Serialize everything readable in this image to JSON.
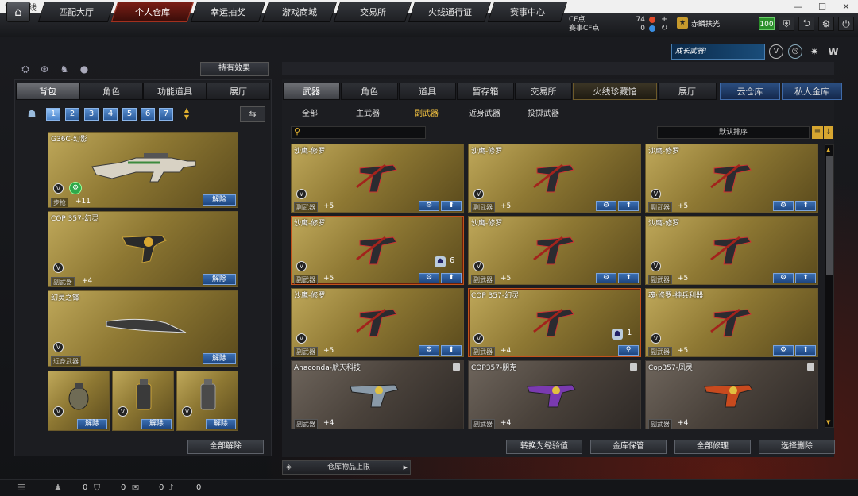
{
  "window": {
    "title": "穿越火线"
  },
  "nav": {
    "tabs": [
      "匹配大厅",
      "个人仓库",
      "幸运抽奖",
      "游戏商城",
      "交易所",
      "火线通行证",
      "赛事中心"
    ],
    "active": "个人仓库"
  },
  "currency": {
    "cf_label": "CF点",
    "cf_value": "74",
    "event_label": "赛事CF点",
    "event_value": "0"
  },
  "user": {
    "name": "赤鳞扶光",
    "level": "100"
  },
  "banner": {
    "growth_weapon": "成长武器!"
  },
  "left": {
    "effect_button": "持有效果",
    "tabs": [
      "背包",
      "角色",
      "功能道具",
      "展厅"
    ],
    "active_tab": "背包",
    "slots": [
      "1",
      "2",
      "3",
      "4",
      "5",
      "6",
      "7"
    ],
    "active_slot": "1",
    "items": [
      {
        "name": "G36C-幻影",
        "type": "步枪",
        "duration": "+11",
        "action": "解除"
      },
      {
        "name": "COP 357-幻灵",
        "type": "副武器",
        "duration": "+4",
        "action": "解除"
      },
      {
        "name": "幻灵之锋",
        "type": "近身武器",
        "duration": "",
        "action": "解除"
      }
    ],
    "throwables": [
      {
        "action": "解除"
      },
      {
        "action": "解除"
      },
      {
        "action": "解除"
      }
    ],
    "release_all": "全部解除"
  },
  "right": {
    "tabs": [
      "武器",
      "角色",
      "道具",
      "暂存箱",
      "交易所",
      "火线珍藏馆",
      "展厅"
    ],
    "active_tab": "武器",
    "storage_tabs": [
      "云仓库",
      "私人金库"
    ],
    "filters": [
      "全部",
      "主武器",
      "副武器",
      "近身武器",
      "投掷武器"
    ],
    "active_filter": "副武器",
    "search_placeholder": "",
    "sort": "默认排序",
    "items": [
      {
        "name": "沙鹰-修罗",
        "type": "副武器",
        "duration": "+5",
        "count": ""
      },
      {
        "name": "沙鹰-修罗",
        "type": "副武器",
        "duration": "+5",
        "count": ""
      },
      {
        "name": "沙鹰-修罗",
        "type": "副武器",
        "duration": "+5",
        "count": ""
      },
      {
        "name": "沙鹰-修罗",
        "type": "副武器",
        "duration": "+5",
        "count": "6"
      },
      {
        "name": "沙鹰-修罗",
        "type": "副武器",
        "duration": "+5",
        "count": ""
      },
      {
        "name": "沙鹰-修罗",
        "type": "副武器",
        "duration": "+5",
        "count": ""
      },
      {
        "name": "沙鹰-修罗",
        "type": "副武器",
        "duration": "+5",
        "count": ""
      },
      {
        "name": "COP 357-幻灵",
        "type": "副武器",
        "duration": "+4",
        "count": "1"
      },
      {
        "name": "魂·修罗-神兵利器",
        "type": "副武器",
        "duration": "+5",
        "count": ""
      },
      {
        "name": "Anaconda-航天科技",
        "type": "副武器",
        "duration": "+4",
        "count": ""
      },
      {
        "name": "COP357-朋克",
        "type": "副武器",
        "duration": "+4",
        "count": ""
      },
      {
        "name": "Cop357-凤灵",
        "type": "副武器",
        "duration": "+4",
        "count": ""
      }
    ],
    "actions": [
      "转换为经验值",
      "金库保管",
      "全部修理",
      "选择删除"
    ],
    "capacity": "仓库物品上限"
  },
  "status": {
    "values": [
      "0",
      "0",
      "0",
      "0"
    ]
  },
  "colors": {
    "accent_red": "#7a1e16",
    "blue_button": "#2a5a9a",
    "gold_card": "#bfa85a"
  }
}
